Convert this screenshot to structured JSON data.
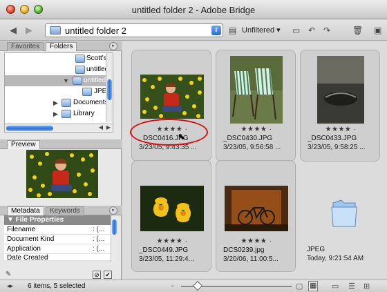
{
  "window": {
    "title": "untitled folder 2 - Adobe Bridge"
  },
  "toolbar": {
    "path": "untitled folder 2",
    "filter": "Unfiltered",
    "icons": [
      "back-icon",
      "forward-icon",
      "folder-icon",
      "path-dropdown-icon",
      "filter-icon",
      "new-folder-icon",
      "rotate-left-icon",
      "rotate-right-icon",
      "trash-icon",
      "compact-mode-icon"
    ]
  },
  "folders_panel": {
    "tabs": [
      "Favorites",
      "Folders"
    ],
    "items": [
      {
        "label": "Scott's U",
        "expanded": null
      },
      {
        "label": "untitled",
        "expanded": null
      },
      {
        "label": "untitled",
        "expanded": true,
        "selected": true
      },
      {
        "label": "JPEG",
        "expanded": null
      },
      {
        "label": "Documents",
        "expanded": false
      },
      {
        "label": "Library",
        "expanded": false
      }
    ]
  },
  "preview_panel": {
    "tab": "Preview"
  },
  "metadata_panel": {
    "tabs": [
      "Metadata",
      "Keywords"
    ],
    "section": "File Properties",
    "rows": [
      {
        "key": "Filename",
        "value": ": (..."
      },
      {
        "key": "Document Kind",
        "value": ": (..."
      },
      {
        "key": "Application",
        "value": ": (..."
      },
      {
        "key": "Date Created",
        "value": ""
      }
    ]
  },
  "content": {
    "items": [
      {
        "name": "DSC0416.JPG",
        "date": "3/23/05, 9:43:35 ...",
        "stars": "★★★★ ·"
      },
      {
        "name": "_DSC0430.JPG",
        "date": "3/23/05, 9:56:58 ...",
        "stars": "★★★★ ·"
      },
      {
        "name": "_DSC0433.JPG",
        "date": "3/23/05, 9:58:25 ...",
        "stars": "★★★★ ·"
      },
      {
        "name": "_DSC0449.JPG",
        "date": "3/23/05, 11:29:4...",
        "stars": "★★★★ ·"
      },
      {
        "name": "DCS0239.jpg",
        "date": "3/20/06, 11:00:5...",
        "stars": "★★★★ ·"
      },
      {
        "name": "JPEG",
        "date": "Today, 9:21:54 AM",
        "stars": ""
      }
    ]
  },
  "status": {
    "text": "6 items, 5 selected"
  }
}
